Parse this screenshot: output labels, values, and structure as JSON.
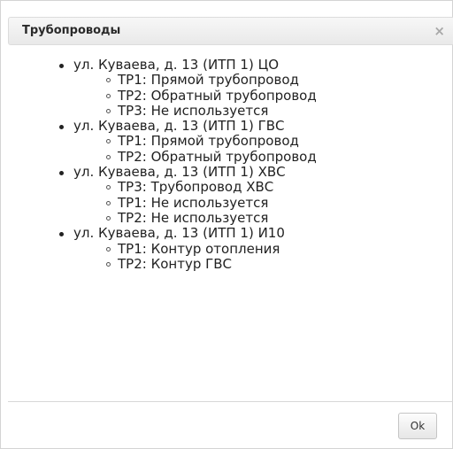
{
  "dialog": {
    "title": "Трубопроводы",
    "close_label": "×",
    "ok_label": "Ok"
  },
  "groups": [
    {
      "label": "ул. Куваева, д. 13 (ИТП 1) ЦО",
      "items": [
        "ТР1: Прямой трубопровод",
        "ТР2: Обратный трубопровод",
        "ТР3: Не используется"
      ]
    },
    {
      "label": "ул. Куваева, д. 13 (ИТП 1) ГВС",
      "items": [
        "ТР1: Прямой трубопровод",
        "ТР2: Обратный трубопровод"
      ]
    },
    {
      "label": "ул. Куваева, д. 13 (ИТП 1) ХВС",
      "items": [
        "ТР3: Трубопровод ХВС",
        "ТР1: Не используется",
        "ТР2: Не используется"
      ]
    },
    {
      "label": "ул. Куваева, д. 13 (ИТП 1) И10",
      "items": [
        "ТР1: Контур отопления",
        "ТР2: Контур ГВС"
      ]
    }
  ]
}
